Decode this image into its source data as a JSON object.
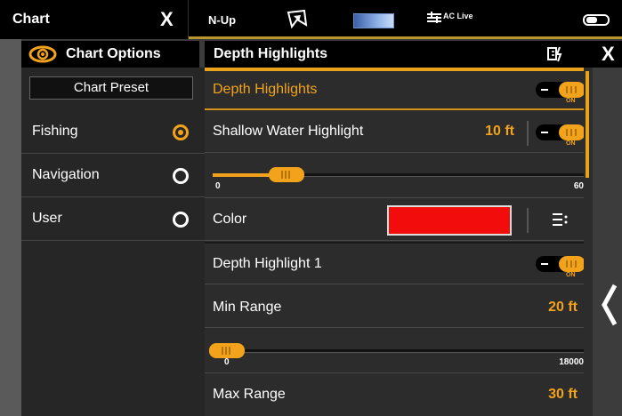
{
  "topbar": {
    "chart_title": "Chart",
    "chart_close": "X",
    "orientation": "N-Up",
    "ac_live": "AC Live"
  },
  "left": {
    "header_title": "Chart Options",
    "preset_label": "Chart Preset",
    "items": [
      {
        "label": "Fishing",
        "selected": true
      },
      {
        "label": "Navigation",
        "selected": false
      },
      {
        "label": "User",
        "selected": false
      }
    ]
  },
  "right": {
    "header_title": "Depth Highlights",
    "close": "X",
    "depth_highlights": {
      "label": "Depth Highlights",
      "toggle": "ON"
    },
    "shallow": {
      "label": "Shallow Water Highlight",
      "value": "10 ft",
      "toggle": "ON",
      "slider_min": "0",
      "slider_max": "60",
      "slider_value": 10
    },
    "color": {
      "label": "Color",
      "swatch": "#f20c0c"
    },
    "depth_highlight_1": {
      "label": "Depth Highlight 1",
      "toggle": "ON"
    },
    "min_range": {
      "label": "Min Range",
      "value": "20 ft",
      "slider_min": "0",
      "slider_max": "18000",
      "slider_value": 20
    },
    "max_range": {
      "label": "Max Range",
      "value": "30 ft"
    }
  },
  "colors": {
    "accent": "#f2a31b",
    "background": "#2c2c2c",
    "header": "#000000"
  }
}
